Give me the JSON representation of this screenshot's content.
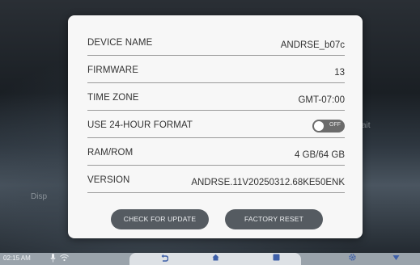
{
  "background": {
    "left_text": "Disp",
    "right_text": "ait"
  },
  "settings": {
    "rows": [
      {
        "label": "DEVICE NAME",
        "value": "ANDRSE_b07c"
      },
      {
        "label": "FIRMWARE",
        "value": "13"
      },
      {
        "label": "TIME ZONE",
        "value": "GMT-07:00"
      },
      {
        "label": "USE 24-HOUR FORMAT",
        "toggle_text": "OFF",
        "toggle_on": false
      },
      {
        "label": "RAM/ROM",
        "value": "4 GB/64 GB"
      },
      {
        "label": "VERSION",
        "value": "ANDRSE.11V20250312.68KE50ENK"
      }
    ],
    "buttons": {
      "check_update": "CHECK FOR UPDATE",
      "factory_reset": "FACTORY RESET"
    }
  },
  "navbar": {
    "time": "02:15 AM",
    "icons": {
      "mic": "mic-icon",
      "wifi": "wifi-icon",
      "back": "back-icon",
      "home": "home-icon",
      "apps": "apps-icon",
      "settings": "gear-icon",
      "collapse": "chevron-down-icon"
    }
  },
  "colors": {
    "panel": "#f7f7f7",
    "button": "#555b61",
    "nav_accent": "#3d5fa8",
    "navbar": "#9aa3ab"
  }
}
